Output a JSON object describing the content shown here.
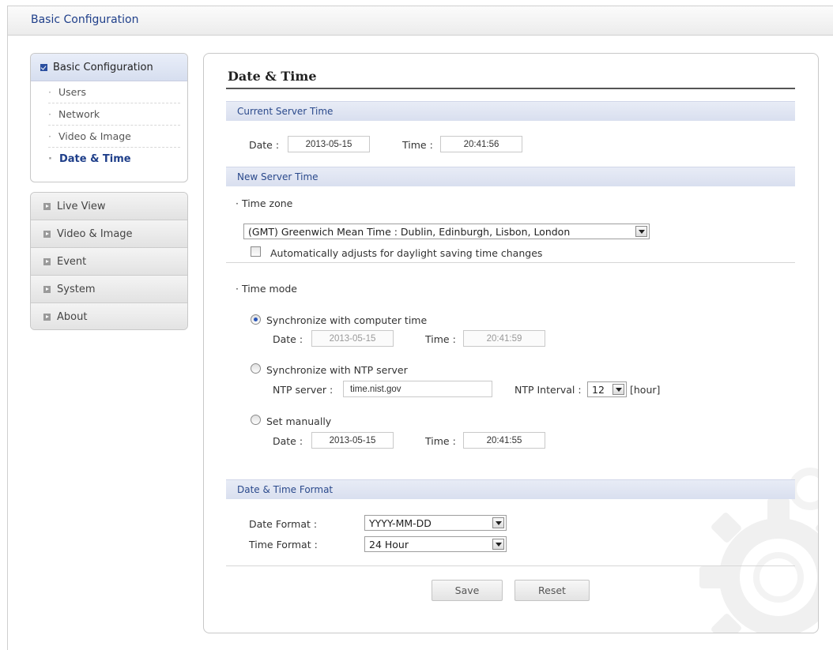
{
  "header": {
    "title": "Basic Configuration"
  },
  "sidebar": {
    "group": {
      "label": "Basic Configuration",
      "items": [
        {
          "label": "Users"
        },
        {
          "label": "Network"
        },
        {
          "label": "Video & Image"
        },
        {
          "label": "Date & Time"
        }
      ]
    },
    "menu": [
      {
        "label": "Live View"
      },
      {
        "label": "Video & Image"
      },
      {
        "label": "Event"
      },
      {
        "label": "System"
      },
      {
        "label": "About"
      }
    ]
  },
  "page": {
    "title": "Date & Time",
    "current": {
      "section": "Current Server Time",
      "date_label": "Date :",
      "date": "2013-05-15",
      "time_label": "Time :",
      "time": "20:41:56"
    },
    "new": {
      "section": "New Server Time",
      "timezone_label": "Time zone",
      "timezone_value": "(GMT) Greenwich Mean Time : Dublin, Edinburgh, Lisbon, London",
      "dst_label": "Automatically adjusts for daylight saving time changes",
      "timemode_label": "Time mode",
      "sync_computer": {
        "label": "Synchronize with computer time",
        "date_label": "Date :",
        "date": "2013-05-15",
        "time_label": "Time :",
        "time": "20:41:59"
      },
      "sync_ntp": {
        "label": "Synchronize with NTP server",
        "server_label": "NTP server :",
        "server": "time.nist.gov",
        "interval_label": "NTP Interval :",
        "interval": "12",
        "interval_unit": "[hour]"
      },
      "manual": {
        "label": "Set manually",
        "date_label": "Date :",
        "date": "2013-05-15",
        "time_label": "Time :",
        "time": "20:41:55"
      }
    },
    "format": {
      "section": "Date & Time Format",
      "date_format_label": "Date Format :",
      "date_format": "YYYY-MM-DD",
      "time_format_label": "Time Format :",
      "time_format": "24 Hour"
    },
    "buttons": {
      "save": "Save",
      "reset": "Reset"
    }
  }
}
